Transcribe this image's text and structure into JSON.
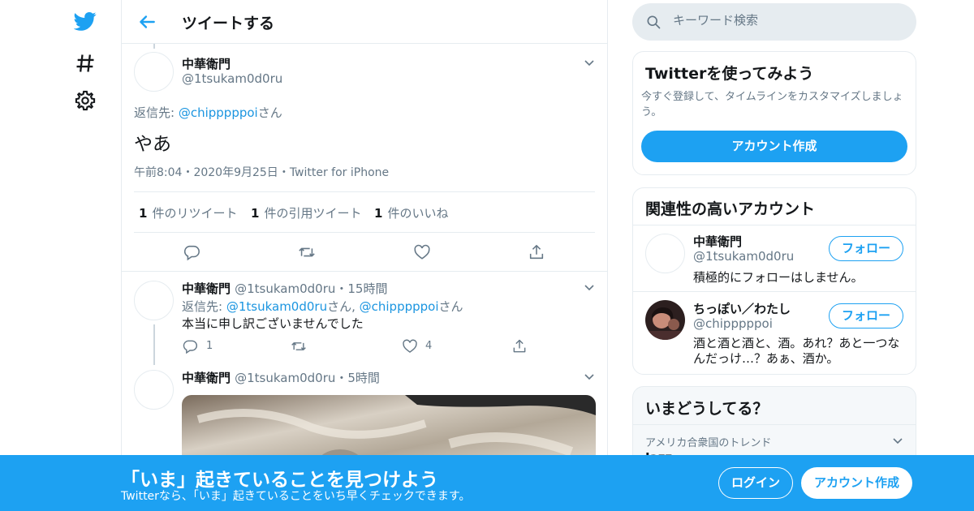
{
  "header": {
    "title": "ツイートする"
  },
  "main_tweet": {
    "name": "中華衛門",
    "handle": "@1tsukam0d0ru",
    "reply_prefix": "返信先: ",
    "reply_to": "@chipppppoi",
    "reply_suffix": "さん",
    "text": "やあ",
    "time": "午前8:04",
    "sep": "・",
    "date": "2020年9月25日",
    "source": "Twitter for iPhone",
    "stats": [
      {
        "count": "1",
        "label": "件のリツイート"
      },
      {
        "count": "1",
        "label": "件の引用ツイート"
      },
      {
        "count": "1",
        "label": "件のいいね"
      }
    ]
  },
  "reply1": {
    "name": "中華衛門",
    "handle": "@1tsukam0d0ru",
    "sep": "・",
    "time": "15時間",
    "reply_prefix": "返信先: ",
    "reply_to_1": "@1tsukam0d0ru",
    "reply_mid": "さん, ",
    "reply_to_2": "@chipppppoi",
    "reply_suffix": "さん",
    "text": "本当に申し訳ございませんでした",
    "reply_count": "1",
    "like_count": "4"
  },
  "reply2": {
    "name": "中華衛門",
    "handle": "@1tsukam0d0ru",
    "sep": "・",
    "time": "5時間"
  },
  "search": {
    "placeholder": "キーワード検索"
  },
  "signup_card": {
    "title": "Twitterを使ってみよう",
    "desc": "今すぐ登録して、タイムラインをカスタマイズしましょう。",
    "button": "アカウント作成"
  },
  "related": {
    "title": "関連性の高いアカウント",
    "accounts": [
      {
        "name": "中華衛門",
        "handle": "@1tsukam0d0ru",
        "bio": "積極的にフォローはしません。",
        "follow": "フォロー"
      },
      {
        "name": "ちっぽい／わたし",
        "handle": "@chipppppoi",
        "bio": "酒と酒と酒と、酒。あれ？あと一つなんだっけ…？あぁ、酒か。",
        "follow": "フォロー"
      }
    ]
  },
  "trends": {
    "title": "いまどうしてる？",
    "location": "アメリカ合衆国のトレンド",
    "first_trend": "Jazz"
  },
  "footer": {
    "title": "「いま」起きていることを見つけよう",
    "subtitle": "Twitterなら、「いま」起きていることをいち早くチェックできます。",
    "login": "ログイン",
    "signup": "アカウント作成"
  },
  "colors": {
    "accent": "#1da1f2",
    "link": "#1b95e0",
    "secondary": "#657786",
    "border": "#e6ecf0"
  },
  "icons": [
    "twitter-bird-icon",
    "hashtag-icon",
    "gear-icon",
    "back-arrow-icon",
    "chevron-down-icon",
    "reply-icon",
    "retweet-icon",
    "like-icon",
    "share-icon",
    "search-icon"
  ]
}
